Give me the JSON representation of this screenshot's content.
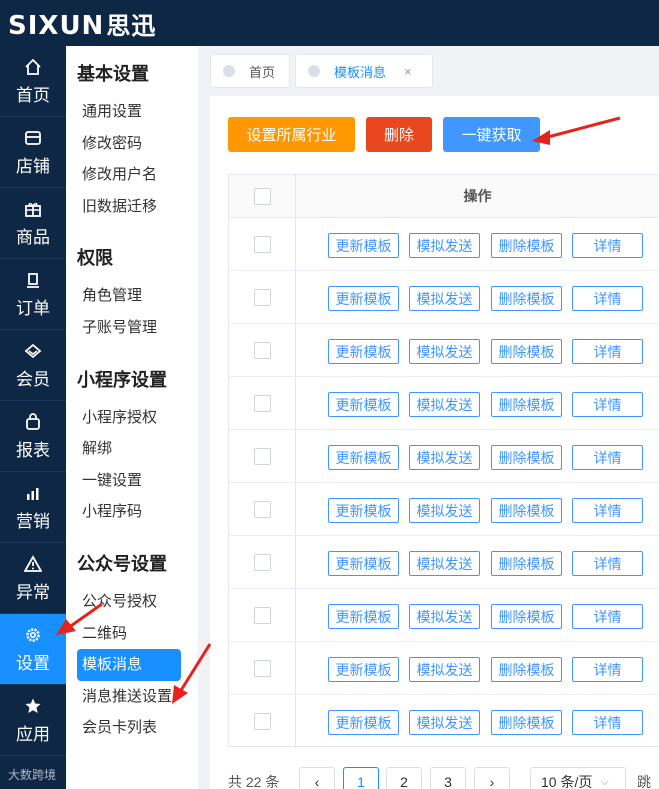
{
  "brand": {
    "logo_text": "SIXUN",
    "logo_cn": "思迅"
  },
  "nav": [
    {
      "label": "首页",
      "icon": "home-icon"
    },
    {
      "label": "店铺",
      "icon": "store-icon"
    },
    {
      "label": "商品",
      "icon": "gift-icon"
    },
    {
      "label": "订单",
      "icon": "order-icon"
    },
    {
      "label": "会员",
      "icon": "member-icon"
    },
    {
      "label": "报表",
      "icon": "report-icon"
    },
    {
      "label": "营销",
      "icon": "chart-icon"
    },
    {
      "label": "异常",
      "icon": "warning-icon"
    },
    {
      "label": "设置",
      "icon": "gear-icon",
      "active": true
    },
    {
      "label": "应用",
      "icon": "star-icon"
    }
  ],
  "submenu": {
    "sections": [
      {
        "title": "基本设置",
        "items": [
          "通用设置",
          "修改密码",
          "修改用户名",
          "旧数据迁移"
        ]
      },
      {
        "title": "权限",
        "items": [
          "角色管理",
          "子账号管理"
        ]
      },
      {
        "title": "小程序设置",
        "items": [
          "小程序授权",
          "解绑",
          "一键设置",
          "小程序码"
        ]
      },
      {
        "title": "公众号设置",
        "items": [
          "公众号授权",
          "二维码",
          "模板消息",
          "消息推送设置",
          "会员卡列表"
        ]
      }
    ],
    "active_item": "模板消息"
  },
  "tabs": [
    {
      "label": "首页"
    },
    {
      "label": "模板消息",
      "close": "×"
    }
  ],
  "toolbar": {
    "industry_label": "设置所属行业",
    "delete_label": "删除",
    "fetch_label": "一键获取"
  },
  "table": {
    "header_op": "操作",
    "row_count": 10,
    "actions": [
      "更新模板",
      "模拟发送",
      "删除模板",
      "详情"
    ]
  },
  "pagination": {
    "total_text": "共 22 条",
    "prev": "‹",
    "pages": [
      "1",
      "2",
      "3"
    ],
    "current": "1",
    "next": "›",
    "page_size": "10 条/页",
    "jump": "跳"
  },
  "watermark": "大数跨境",
  "colors": {
    "nav_bg": "#0e2744",
    "accent": "#1890ff",
    "orange": "#ff9800",
    "red": "#e8461c",
    "arrow": "#e5231b"
  }
}
